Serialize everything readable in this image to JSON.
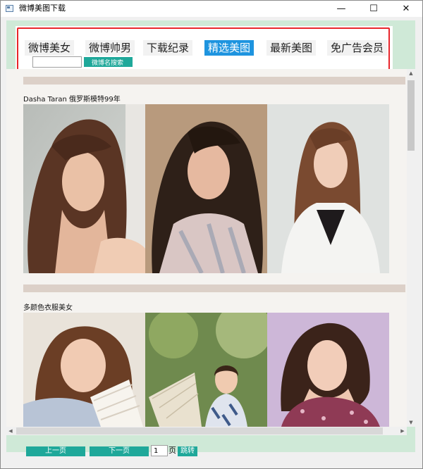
{
  "window": {
    "title": "微博美图下载",
    "controls": {
      "minimize": "—",
      "maximize": "☐",
      "close": "✕"
    }
  },
  "nav": {
    "tabs": [
      {
        "label": "微博美女",
        "active": false
      },
      {
        "label": "微博帅男",
        "active": false
      },
      {
        "label": "下载纪录",
        "active": false
      },
      {
        "label": "精选美图",
        "active": true
      },
      {
        "label": "最新美图",
        "active": false
      },
      {
        "label": "免广告会员",
        "active": false
      }
    ],
    "search": {
      "value": "",
      "placeholder": "",
      "button_label": "微博名搜索"
    }
  },
  "gallery": {
    "sections": [
      {
        "title": "Dasha Taran 俄罗斯模特99年",
        "photo_count": 3
      },
      {
        "title": "多颜色衣服美女",
        "photo_count": 3
      }
    ]
  },
  "pager": {
    "prev_label": "上一页",
    "next_label": "下一页",
    "page_value": "1",
    "page_suffix": "页",
    "jump_label": "跳转"
  },
  "colors": {
    "accent_teal": "#1fa89a",
    "active_tab": "#1e94df",
    "highlight_outline": "#e8262b",
    "frame_mint": "#cfe9d7",
    "section_band": "#dcd0c8"
  }
}
